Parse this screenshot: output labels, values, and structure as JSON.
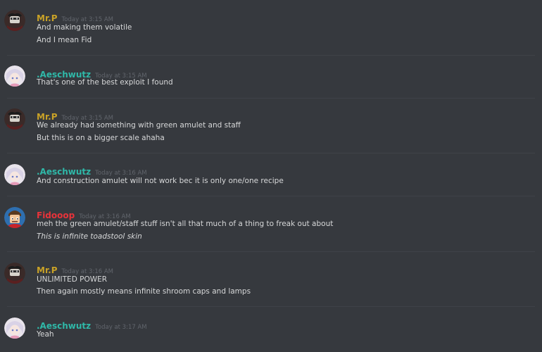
{
  "colors": {
    "background": "#36393e",
    "divider": "#3f4248",
    "timestamp": "#61656c",
    "message_text": "#d7d8d9"
  },
  "messages": [
    {
      "author": "Mr.P",
      "author_color": "#c9a227",
      "avatar": "mrp-avatar",
      "timestamp": "Today at 3:15 AM",
      "lines": [
        "And making them volatile",
        "And I mean Fid"
      ]
    },
    {
      "author": ".Aeschwutz",
      "author_color": "#2fb8a8",
      "avatar": "aeschwutz-avatar",
      "timestamp": "Today at 3:15 AM",
      "lines": [
        "That's one of the best exploit I found"
      ]
    },
    {
      "author": "Mr.P",
      "author_color": "#c9a227",
      "avatar": "mrp-avatar",
      "timestamp": "Today at 3:15 AM",
      "lines": [
        "We already had something with green amulet and staff",
        "But this is on a bigger scale ahaha"
      ]
    },
    {
      "author": ".Aeschwutz",
      "author_color": "#2fb8a8",
      "avatar": "aeschwutz-avatar",
      "timestamp": "Today at 3:16 AM",
      "lines": [
        "And construction amulet will not work bec it is only one/one recipe"
      ]
    },
    {
      "author": "Fidooop",
      "author_color": "#e8333a",
      "avatar": "fidooop-avatar",
      "timestamp": "Today at 3:16 AM",
      "lines": [
        "meh the green amulet/staff stuff isn't all that much of a thing to freak out about",
        "This is infinite toadstool skin"
      ]
    },
    {
      "author": "Mr.P",
      "author_color": "#c9a227",
      "avatar": "mrp-avatar",
      "timestamp": "Today at 3:16 AM",
      "lines": [
        "UNLIMITED POWER",
        "Then again mostly means infinite shroom caps and lamps"
      ]
    },
    {
      "author": ".Aeschwutz",
      "author_color": "#2fb8a8",
      "avatar": "aeschwutz-avatar",
      "timestamp": "Today at 3:17 AM",
      "lines": [
        "Yeah"
      ]
    }
  ]
}
